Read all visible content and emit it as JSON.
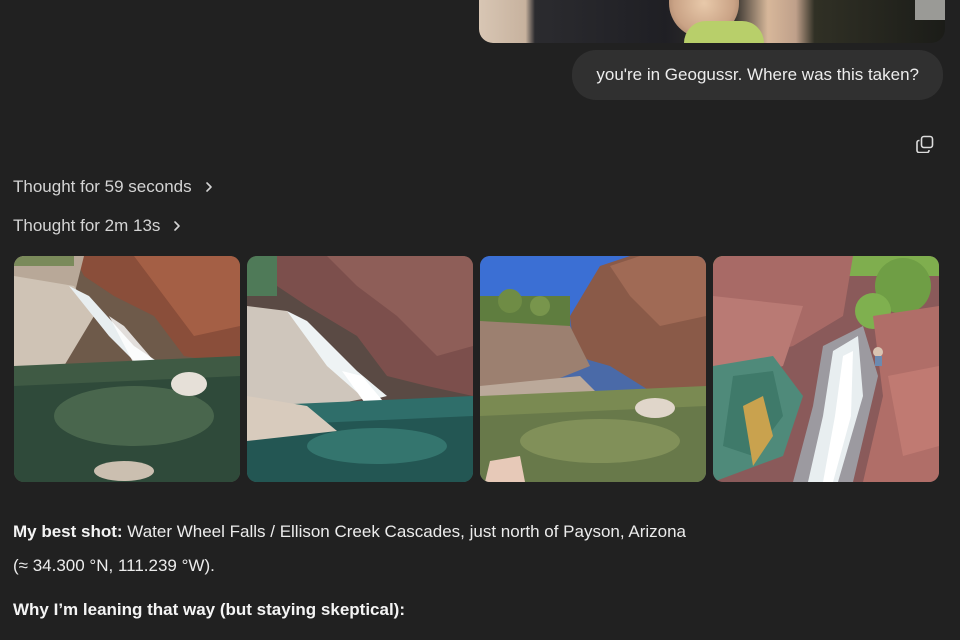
{
  "user_message": {
    "text": "you're in Geogussr. Where was this taken?"
  },
  "thoughts": [
    {
      "label": "Thought for 59 seconds"
    },
    {
      "label": "Thought for 2m 13s"
    }
  ],
  "icons": {
    "copy": "copy-icon",
    "chevron": "chevron-right-icon"
  },
  "gallery": {
    "images": [
      {
        "subject": "waterfall-pool-red-cliffs"
      },
      {
        "subject": "cascade-over-rocks-into-pool"
      },
      {
        "subject": "creek-pool-blue-sky"
      },
      {
        "subject": "waterfall-colorful-rock"
      }
    ]
  },
  "answer": {
    "best_shot_label": "My best shot:",
    "best_shot_text": " Water Wheel Falls / Ellison Creek Cascades, just north of Payson, Arizona",
    "coordinates": "(≈ 34.300 °N, 111.239 °W).",
    "reason_heading": "Why I’m leaning that way (but staying skeptical):"
  },
  "colors": {
    "background": "#212121",
    "bubble": "#303030",
    "text": "#ececec",
    "muted": "#d4d4d4"
  }
}
